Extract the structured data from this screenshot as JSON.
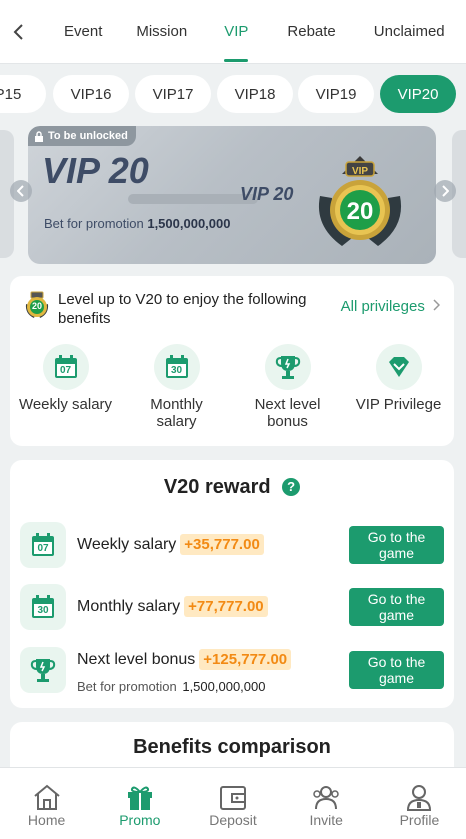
{
  "tabs": [
    "Event",
    "Mission",
    "VIP",
    "Rebate",
    "Unclaimed"
  ],
  "levels": [
    "P15",
    "VIP16",
    "VIP17",
    "VIP18",
    "VIP19",
    "VIP20"
  ],
  "banner": {
    "lock_label": "To be unlocked",
    "vip_big": "VIP 20",
    "vip_small": "VIP 20",
    "bet_label": "Bet for promotion",
    "bet_value": "1,500,000,000",
    "badge_number": "20",
    "badge_tag": "VIP"
  },
  "levelup": {
    "badge_number": "20",
    "text": "Level up to V20 to enjoy the following benefits",
    "all_privileges": "All privileges"
  },
  "benefits": [
    {
      "label": "Weekly salary",
      "icon_text": "07"
    },
    {
      "label": "Monthly salary",
      "icon_text": "30"
    },
    {
      "label": "Next level bonus",
      "icon_text": ""
    },
    {
      "label": "VIP Privilege",
      "icon_text": ""
    }
  ],
  "reward": {
    "title": "V20 reward",
    "help": "?",
    "rows": [
      {
        "label": "Weekly salary",
        "amount": "+35,777.00",
        "button": "Go to the game",
        "icon_text": "07"
      },
      {
        "label": "Monthly salary",
        "amount": "+77,777.00",
        "button": "Go to the game",
        "icon_text": "30"
      },
      {
        "label": "Next level bonus",
        "amount": "+125,777.00",
        "button": "Go to the game",
        "sub_label": "Bet for promotion",
        "sub_value": "1,500,000,000"
      }
    ]
  },
  "benefits_comparison": {
    "title": "Benefits comparison"
  },
  "nav": [
    "Home",
    "Promo",
    "Deposit",
    "Invite",
    "Profile"
  ],
  "colors": {
    "accent": "#1c9b6e",
    "amount": "#f28a14",
    "amount_bg": "#ffe9c2"
  }
}
